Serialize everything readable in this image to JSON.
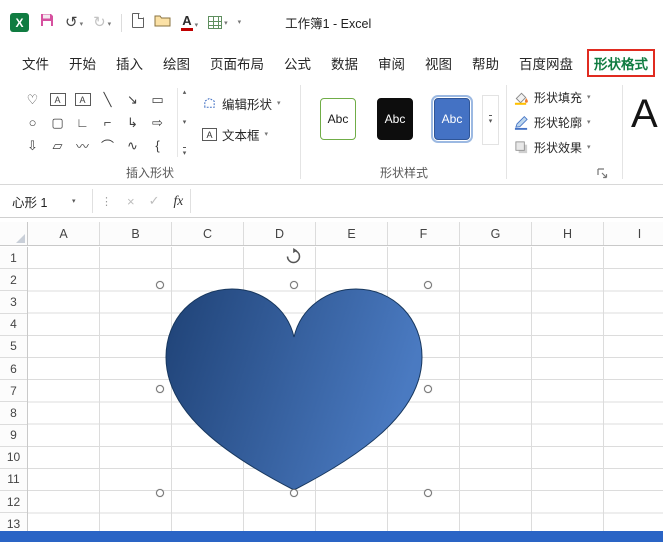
{
  "titlebar": {
    "title": "工作簿1 - Excel",
    "logo_letter": "X",
    "undo_glyph": "↺",
    "redo_glyph": "↻",
    "font_color_letter": "A",
    "caret": "▾"
  },
  "tabs": {
    "items": [
      {
        "label": "文件",
        "active": false
      },
      {
        "label": "开始",
        "active": false
      },
      {
        "label": "插入",
        "active": false
      },
      {
        "label": "绘图",
        "active": false
      },
      {
        "label": "页面布局",
        "active": false
      },
      {
        "label": "公式",
        "active": false
      },
      {
        "label": "数据",
        "active": false
      },
      {
        "label": "审阅",
        "active": false
      },
      {
        "label": "视图",
        "active": false
      },
      {
        "label": "帮助",
        "active": false
      },
      {
        "label": "百度网盘",
        "active": false
      },
      {
        "label": "形状格式",
        "active": true
      }
    ]
  },
  "ribbon": {
    "insert_shapes": {
      "group_label": "插入形状",
      "gallery": [
        {
          "glyph": "♡",
          "name": "heart-shape",
          "boxed": false
        },
        {
          "glyph": "A",
          "name": "text-box",
          "boxed": true
        },
        {
          "glyph": "A",
          "name": "vertical-text-box",
          "boxed": true
        },
        {
          "glyph": "╲",
          "name": "line",
          "boxed": false
        },
        {
          "glyph": "↘",
          "name": "line-arrow",
          "boxed": false
        },
        {
          "glyph": "▭",
          "name": "rectangle",
          "boxed": false
        },
        {
          "glyph": "○",
          "name": "oval",
          "boxed": false
        },
        {
          "glyph": "▢",
          "name": "rounded-rectangle",
          "boxed": false
        },
        {
          "glyph": "∟",
          "name": "elbow-connector",
          "boxed": false
        },
        {
          "glyph": "⌐",
          "name": "elbow-connector-2",
          "boxed": false
        },
        {
          "glyph": "↳",
          "name": "bent-arrow-connector",
          "boxed": false
        },
        {
          "glyph": "⇨",
          "name": "right-arrow",
          "boxed": false
        },
        {
          "glyph": "⇩",
          "name": "down-arrow",
          "boxed": false
        },
        {
          "glyph": "▱",
          "name": "parallelogram",
          "boxed": false
        },
        {
          "glyph": "〰",
          "name": "scribble",
          "boxed": false
        },
        {
          "glyph": "⌒",
          "name": "arc",
          "boxed": false
        },
        {
          "glyph": "∿",
          "name": "curve",
          "boxed": false
        },
        {
          "glyph": "{",
          "name": "left-brace",
          "boxed": false
        }
      ],
      "scroll_up": "▴",
      "scroll_down": "▾",
      "edit_shape_label": "编辑形状",
      "text_box_label": "文本框"
    },
    "shape_styles": {
      "group_label": "形状样式",
      "styles": [
        {
          "label": "Abc"
        },
        {
          "label": "Abc"
        },
        {
          "label": "Abc"
        }
      ]
    },
    "format_buttons": {
      "fill_label": "形状填充",
      "outline_label": "形状轮廓",
      "effects_label": "形状效果"
    },
    "wordart_letter": "A"
  },
  "formula_bar": {
    "name_box_value": "心形 1",
    "cancel_glyph": "×",
    "enter_glyph": "✓",
    "fx_label": "fx",
    "formula_value": ""
  },
  "grid": {
    "columns": [
      "A",
      "B",
      "C",
      "D",
      "E",
      "F",
      "G",
      "H",
      "I"
    ],
    "rows": [
      "1",
      "2",
      "3",
      "4",
      "5",
      "6",
      "7",
      "8",
      "9",
      "10",
      "11",
      "12",
      "13"
    ]
  },
  "shape": {
    "name": "心形 1",
    "type": "heart",
    "fill_gradient_start": "#1F4276",
    "fill_gradient_end": "#4A7AC1",
    "stroke": "#17375E"
  },
  "colors": {
    "active_tab_green": "#107C41",
    "annotation_red": "#E02B20",
    "status_bar_blue": "#2A64C5",
    "style1_border": "#70AD47",
    "style2_bg": "#0D0D0D",
    "style3_bg": "#4472C4"
  }
}
